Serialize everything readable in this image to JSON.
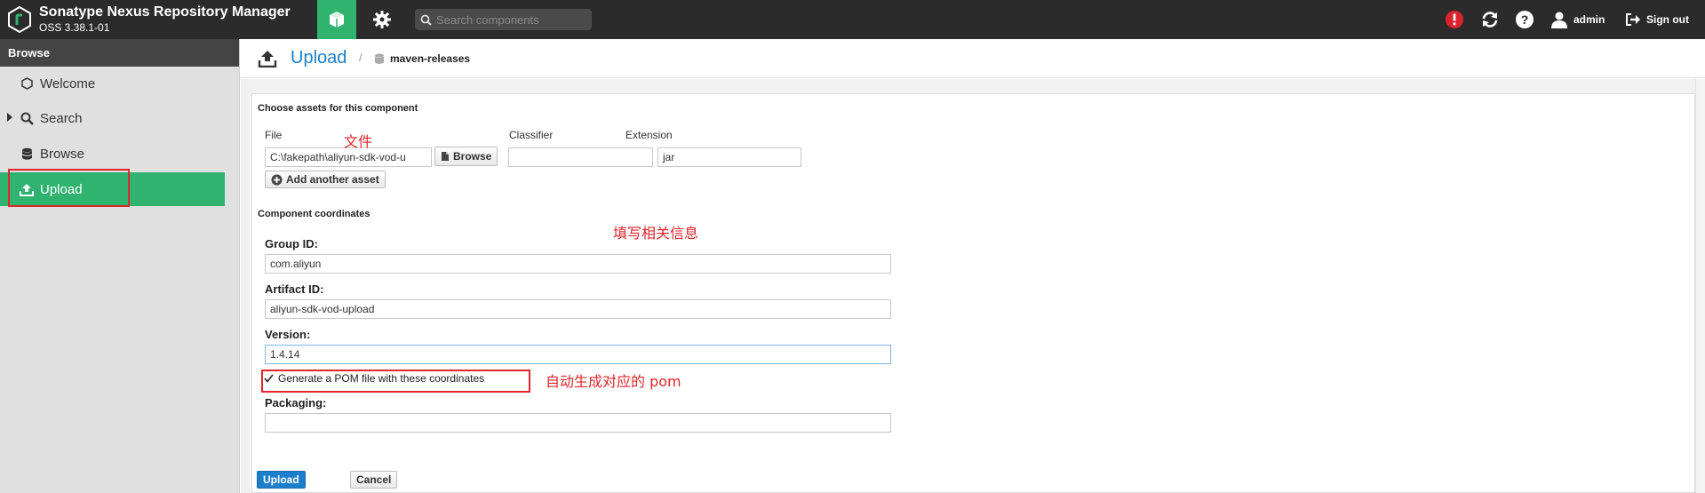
{
  "header": {
    "app_title": "Sonatype Nexus Repository Manager",
    "app_version": "OSS 3.38.1-01",
    "search_placeholder": "Search components",
    "user": "admin",
    "signout": "Sign out",
    "colors": {
      "bar": "#2b2b2b",
      "accent": "#2fb36f",
      "alert": "#d9232e"
    }
  },
  "sidebar": {
    "title": "Browse",
    "items": [
      {
        "label": "Welcome",
        "icon": "hexagon-icon"
      },
      {
        "label": "Search",
        "icon": "search-icon"
      },
      {
        "label": "Browse",
        "icon": "database-icon"
      },
      {
        "label": "Upload",
        "icon": "upload-icon",
        "active": true
      }
    ]
  },
  "page": {
    "title": "Upload",
    "breadcrumb_sep": "/",
    "repository": "maven-releases"
  },
  "form": {
    "assets_title": "Choose assets for this component",
    "file_label": "File",
    "file_value": "C:\\fakepath\\aliyun-sdk-vod-u",
    "browse_button": "Browse",
    "classifier_label": "Classifier",
    "classifier_value": "",
    "extension_label": "Extension",
    "extension_value": "jar",
    "add_asset_button": "Add another asset",
    "coordinates_title": "Component coordinates",
    "group_label": "Group ID:",
    "group_value": "com.aliyun",
    "artifact_label": "Artifact ID:",
    "artifact_value": "aliyun-sdk-vod-upload",
    "version_label": "Version:",
    "version_value": "1.4.14",
    "generate_pom_label": "Generate a POM file with these coordinates",
    "generate_pom_checked": true,
    "packaging_label": "Packaging:",
    "packaging_value": "",
    "upload_button": "Upload",
    "cancel_button": "Cancel"
  },
  "annotations": {
    "file": "文件",
    "fill_info": "填写相关信息",
    "auto_pom": "自动生成对应的 pom"
  }
}
